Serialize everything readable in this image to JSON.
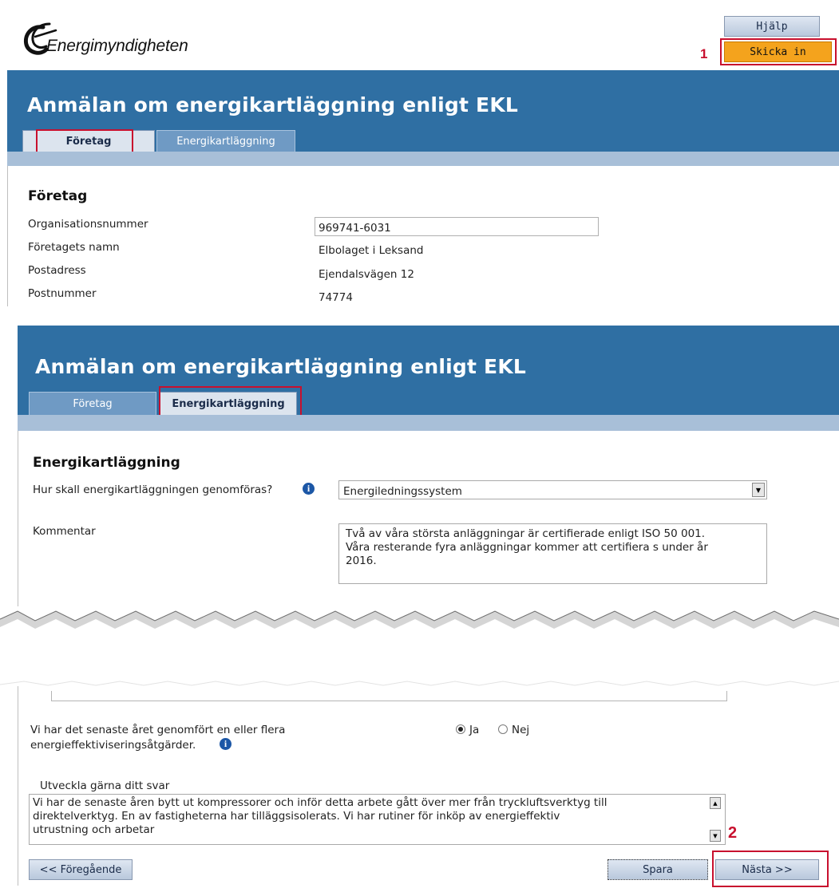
{
  "header": {
    "logo_text": "Energimyndigheten",
    "help_label": "Hjälp",
    "submit_label": "Skicka in",
    "callout_1": "1",
    "callout_2": "2"
  },
  "page1": {
    "title": "Anmälan om energikartläggning enligt EKL",
    "tabs": [
      {
        "label": "Företag",
        "active": true
      },
      {
        "label": "Energikartläggning",
        "active": false
      }
    ],
    "section_heading": "Företag",
    "fields": [
      {
        "label": "Organisationsnummer",
        "value": "969741-6031"
      },
      {
        "label": "Företagets namn",
        "value": "Elbolaget i Leksand"
      },
      {
        "label": "Postadress",
        "value": "Ejendalsvägen 12"
      },
      {
        "label": "Postnummer",
        "value": "74774"
      }
    ]
  },
  "page2": {
    "title": "Anmälan om energikartläggning enligt EKL",
    "tabs": [
      {
        "label": "Företag",
        "active": false
      },
      {
        "label": "Energikartläggning",
        "active": true
      }
    ],
    "section_heading": "Energikartläggning",
    "method_label": "Hur skall energikartläggningen genomföras?",
    "method_value": "Energiledningssystem",
    "comment_label": "Kommentar",
    "comment_lines": [
      "Två av våra största anläggningar är certifierade enligt ISO 50 001.",
      "Våra resterande fyra anläggningar kommer att certifiera s under år",
      "2016."
    ],
    "measures_label_line1": "Vi har det senaste året genomfört en eller flera",
    "measures_label_line2": "energieffektiviseringsåtgärder.",
    "radio_yes": "Ja",
    "radio_no": "Nej",
    "radio_selected": "Ja",
    "elaborate_label": "Utveckla gärna ditt svar",
    "elaborate_lines": [
      "Vi har de senaste åren bytt ut kompressorer och inför detta arbete gått över mer från tryckluftsverktyg till",
      "direktelverktyg. En av fastigheterna har tilläggsisolerats. Vi har rutiner för inköp av energieffektiv",
      "utrustning och arbetar"
    ]
  },
  "footer": {
    "prev_label": "<< Föregående",
    "save_label": "Spara",
    "next_label": "Nästa >>"
  },
  "colors": {
    "banner": "#2f6fa3",
    "submit": "#f4a31d",
    "highlight": "#c8102e"
  }
}
